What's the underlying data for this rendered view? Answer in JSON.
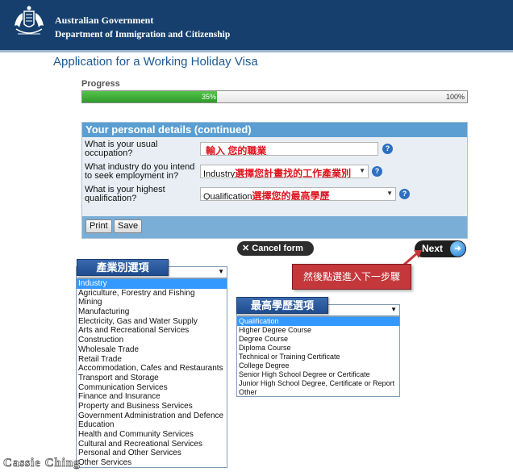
{
  "header": {
    "gov_name": "Australian Government",
    "dept_name": "Department of Immigration and Citizenship",
    "bg_color": "#163f6d"
  },
  "app_title": "Application for a Working Holiday Visa",
  "progress": {
    "label": "Progress",
    "value_percent": 35,
    "value_label": "35%",
    "max_label": "100%"
  },
  "section": {
    "title": "Your personal details (continued)",
    "questions": [
      {
        "label": "What is your usual occupation?",
        "value": "",
        "note": "輸入 您的職業",
        "help_icon": "question-icon"
      },
      {
        "label": "What industry do you intend to seek employment in?",
        "value": "Industry",
        "note": "選擇您計畫找的工作產業別",
        "help_icon": "question-icon"
      },
      {
        "label": "What is your highest qualification?",
        "value": "Qualification",
        "note": "選擇您的最高學歷",
        "help_icon": "question-icon"
      }
    ],
    "print_label": "Print",
    "save_label": "Save"
  },
  "nav": {
    "cancel_label": "Cancel form",
    "next_label": "Next"
  },
  "callout": "然後點選進入下一步驟",
  "industry": {
    "tag": "產業別選項",
    "options": [
      "Industry",
      "Agriculture, Forestry and Fishing",
      "Mining",
      "Manufacturing",
      "Electricity, Gas and Water Supply",
      "Arts and Recreational Services",
      "Construction",
      "Wholesale Trade",
      "Retail Trade",
      "Accommodation, Cafes and Restaurants",
      "Transport and Storage",
      "Communication Services",
      "Finance and Insurance",
      "Property and Business Services",
      "Government Administration and Defence",
      "Education",
      "Health and Community Services",
      "Cultural and Recreational Services",
      "Personal and Other Services",
      "Other Services"
    ],
    "selected_index": 0
  },
  "qualification": {
    "tag": "最高學歷選項",
    "options": [
      "Qualification",
      "Higher Degree Course",
      "Degree Course",
      "Diploma Course",
      "Technical or Training Certificate",
      "College Degree",
      "Senior High School Degree or Certificate",
      "Junior High School Degree, Certificate or Report",
      "Other"
    ],
    "selected_index": 0
  },
  "watermark": "Cassie Ching"
}
